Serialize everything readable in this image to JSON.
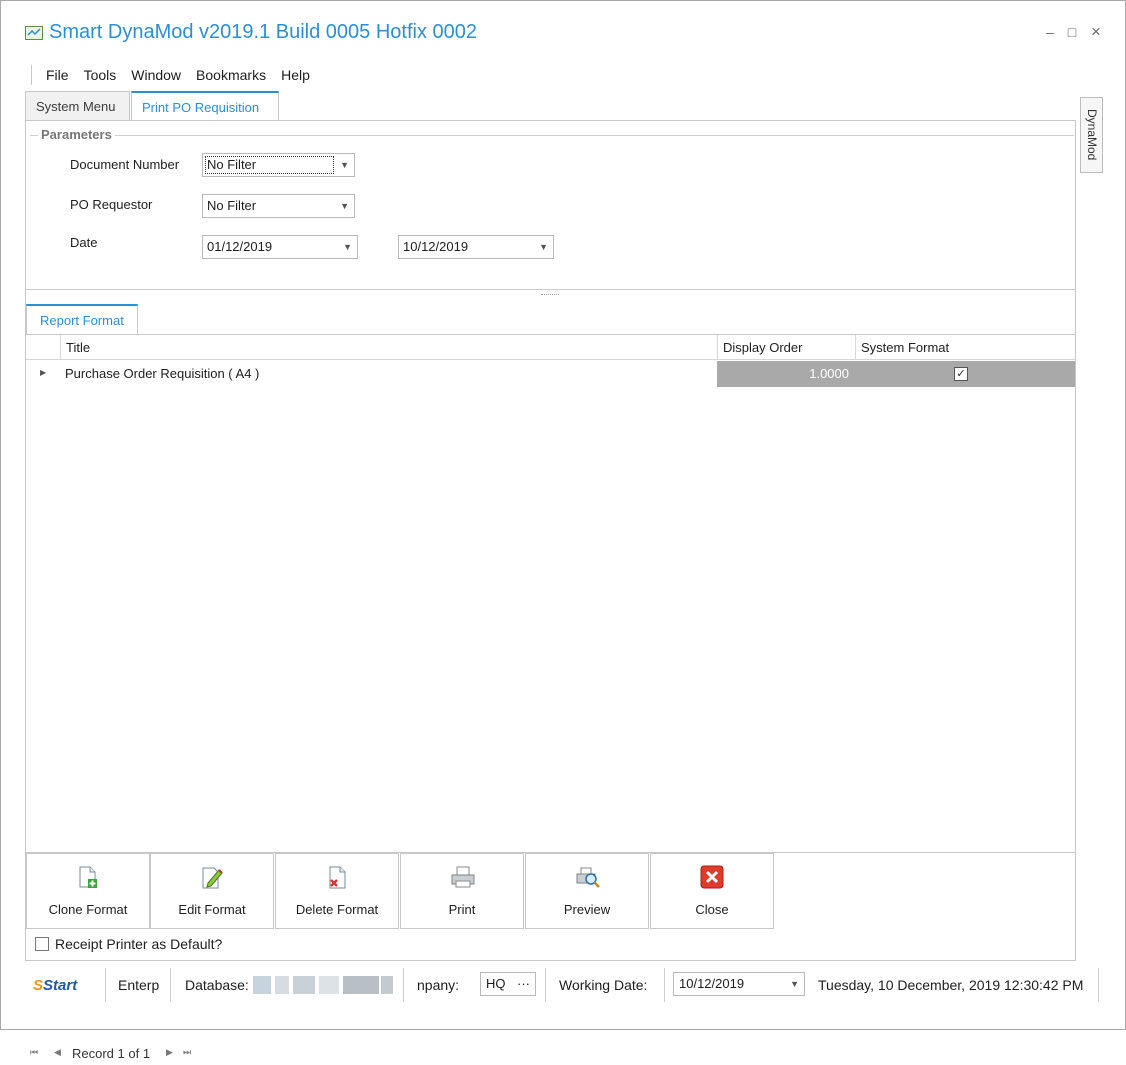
{
  "window": {
    "title": "Smart DynaMod v2019.1 Build 0005 Hotfix 0002",
    "minimize_glyph": "–",
    "maximize_glyph": "□",
    "close_glyph": "×"
  },
  "menu": [
    "File",
    "Tools",
    "Window",
    "Bookmarks",
    "Help"
  ],
  "tabs": [
    {
      "label": "System Menu",
      "active": false
    },
    {
      "label": "Print PO Requisition",
      "active": true
    }
  ],
  "side_tab": "DynaMod",
  "parameters": {
    "title": "Parameters",
    "document_number": {
      "label": "Document Number",
      "value": "No Filter"
    },
    "po_requestor": {
      "label": "PO Requestor",
      "value": "No Filter"
    },
    "date": {
      "label": "Date",
      "from": "01/12/2019",
      "to": "10/12/2019"
    }
  },
  "report_format": {
    "tab_label": "Report Format",
    "columns": [
      "Title",
      "Display Order",
      "System Format"
    ],
    "rows": [
      {
        "title": "Purchase Order Requisition ( A4 )",
        "display_order": "1.0000",
        "system_format": true
      }
    ],
    "navigator": "Record 1 of 1"
  },
  "buttons": [
    {
      "label": "Clone Format",
      "icon": "clone-format-icon"
    },
    {
      "label": "Edit Format",
      "icon": "edit-format-icon"
    },
    {
      "label": "Delete Format",
      "icon": "delete-format-icon"
    },
    {
      "label": "Print",
      "icon": "printer-icon"
    },
    {
      "label": "Preview",
      "icon": "preview-icon"
    },
    {
      "label": "Close",
      "icon": "close-red-icon"
    }
  ],
  "receipt_checkbox": {
    "label": "Receipt Printer as Default?",
    "checked": false
  },
  "status": {
    "logo": "Start",
    "edition": "Enterp",
    "database_label": "Database:",
    "company_label": "npany:",
    "company_value": "HQ",
    "company_button": "···",
    "working_date_label": "Working Date:",
    "working_date_value": "10/12/2019",
    "datetime": "Tuesday, 10 December, 2019 12:30:42 PM"
  },
  "colors": {
    "accent": "#2b8fd6",
    "selection_gray": "#a9a9a9",
    "close_red": "#e03a2b"
  }
}
